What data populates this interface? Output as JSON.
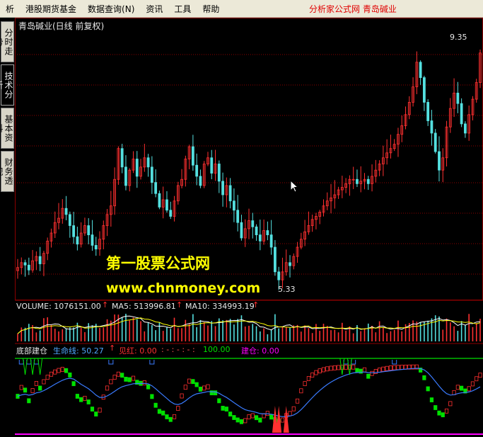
{
  "menubar": {
    "items": [
      "析",
      "港股期货基金",
      "数据查询(N)",
      "资讯",
      "工具",
      "帮助"
    ],
    "brand": "分析家公式网 青岛碱业"
  },
  "sidetabs": [
    {
      "label": "分时走势",
      "active": false
    },
    {
      "label": "技术分析",
      "active": true
    },
    {
      "label": "基本资料",
      "active": false
    },
    {
      "label": "财务透视",
      "active": false
    }
  ],
  "main_panel": {
    "title": "青岛碱业(日线 前复权)",
    "high_label": "9.35",
    "low_label": "5.33"
  },
  "volume_panel": {
    "volume": "VOLUME: 1076151.00",
    "ma5": "MA5: 513996.81",
    "ma10": "MA10: 334993.19"
  },
  "indicator_panel": {
    "name": "底部建仓",
    "lifeline": "生命线: 50.27",
    "jianhong": "见红: 0.00",
    "dashes": ": - : - : - :",
    "hundred": "100.00",
    "jiancang": "建仓: 0.00"
  },
  "watermark": {
    "line1": "第一股票公式网",
    "line2": "www.chnmoney.com"
  },
  "colors": {
    "up": "#ff3030",
    "down": "#54e0e0",
    "grid": "#8b0000",
    "green_band": "#00e000",
    "magenta": "#ff00ff",
    "yellow": "#ffff00"
  },
  "chart_data": {
    "type": "candlestick",
    "closes": [
      5.62,
      5.7,
      5.66,
      5.58,
      5.73,
      5.8,
      5.68,
      5.85,
      6.05,
      6.18,
      6.35,
      6.42,
      6.58,
      6.48,
      6.3,
      6.12,
      6.0,
      6.18,
      6.3,
      6.15,
      5.98,
      5.92,
      6.08,
      6.3,
      6.48,
      6.62,
      7.05,
      7.55,
      7.25,
      6.95,
      7.2,
      7.38,
      7.1,
      7.25,
      7.4,
      7.25,
      7.0,
      6.82,
      6.6,
      6.72,
      6.55,
      6.45,
      6.7,
      6.95,
      7.05,
      7.38,
      7.58,
      7.28,
      7.1,
      6.95,
      7.3,
      7.4,
      7.15,
      7.3,
      7.02,
      6.8,
      6.95,
      6.7,
      6.55,
      6.35,
      6.1,
      6.25,
      6.38,
      6.28,
      6.15,
      6.05,
      6.22,
      6.15,
      5.95,
      5.55,
      5.42,
      5.55,
      5.7,
      5.65,
      5.8,
      5.95,
      6.08,
      6.2,
      6.3,
      6.4,
      6.45,
      6.52,
      6.62,
      6.7,
      6.75,
      6.8,
      6.88,
      6.92,
      6.98,
      7.05,
      7.05,
      6.98,
      7.02,
      7.05,
      6.98,
      7.1,
      7.2,
      7.3,
      7.4,
      7.48,
      7.55,
      7.62,
      7.78,
      7.92,
      8.1,
      8.3,
      8.55,
      8.95,
      8.7,
      8.3,
      8.0,
      7.8,
      7.5,
      7.2,
      7.4,
      7.9,
      8.2,
      8.45,
      8.28,
      7.95,
      7.8,
      8.1,
      8.35,
      8.62,
      9.1
    ],
    "ylim": [
      5.33,
      9.35
    ],
    "lifeline_last": 50.27
  }
}
